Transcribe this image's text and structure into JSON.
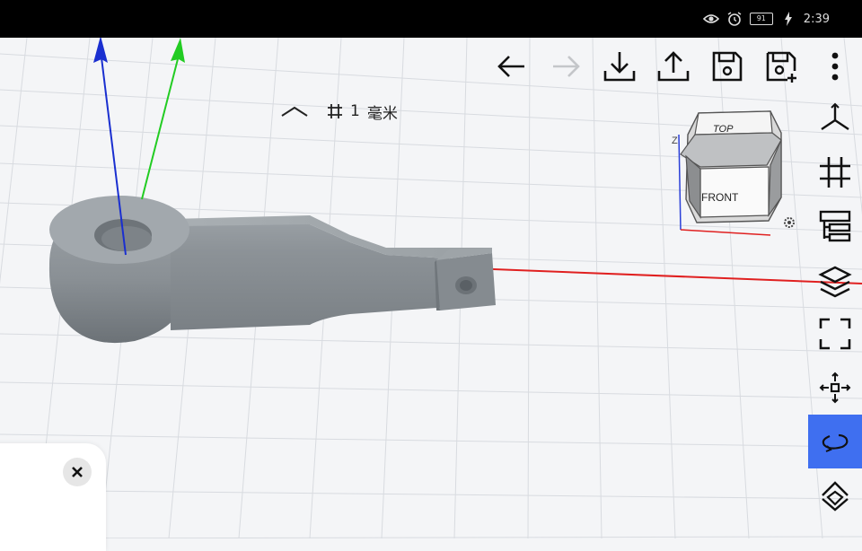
{
  "status_bar": {
    "battery_level": "91",
    "time": "2:39",
    "icons": [
      "eye-icon",
      "alarm-icon",
      "battery-icon",
      "charging-icon"
    ]
  },
  "toolbar": {
    "items": [
      "undo-icon",
      "redo-icon",
      "import-icon",
      "export-icon",
      "save-icon",
      "save-as-icon",
      "more-vert-icon"
    ],
    "redo_disabled": true
  },
  "grid_setting": {
    "spacing_value": "1",
    "unit": "毫米"
  },
  "view_cube": {
    "faces": {
      "top": "TOP",
      "front": "FRONT"
    },
    "axis_letter": "Z"
  },
  "sidebar": {
    "items": [
      "axes-view-icon",
      "grid-toggle-icon",
      "tree-structure-icon",
      "layers-icon",
      "fit-view-icon",
      "pan-move-icon",
      "rotate-icon",
      "transform-icon"
    ],
    "active": "rotate-icon"
  },
  "colors": {
    "accent": "#3f6ff0",
    "x_axis": "#e02020",
    "y_axis": "#22cc22",
    "z_axis": "#1a2fd0",
    "model": "#8a9096",
    "grid": "#d6d9de"
  }
}
